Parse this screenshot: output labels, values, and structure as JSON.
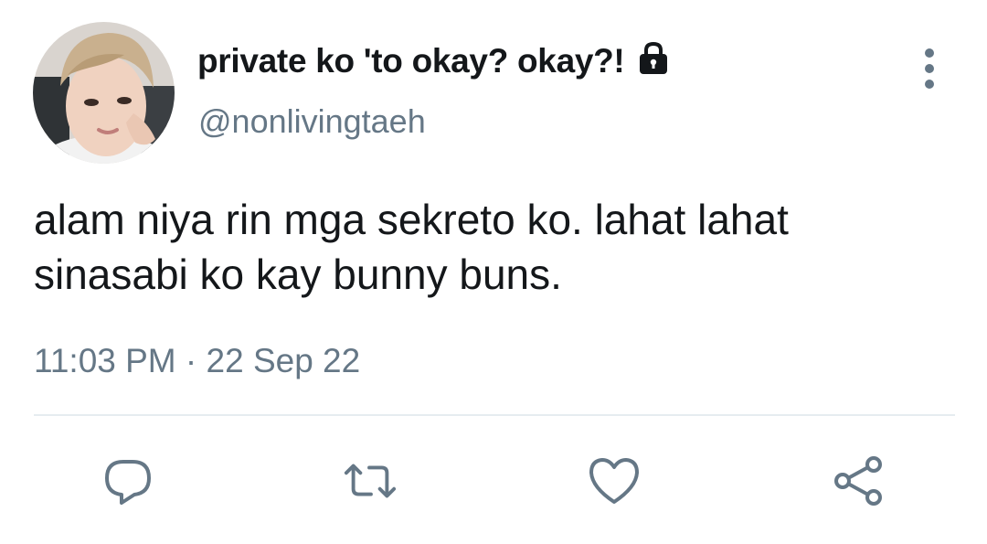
{
  "tweet": {
    "display_name": "private ko 'to okay? okay?!",
    "handle": "@nonlivingtaeh",
    "text": "alam niya rin mga sekreto ko. lahat lahat\nsinasabi ko kay bunny buns.",
    "timestamp": "11:03 PM · 22 Sep 22",
    "protected": true
  },
  "icons": {
    "lock": "lock-icon",
    "more": "vertical-ellipsis-icon",
    "reply": "reply-icon",
    "retweet": "retweet-icon",
    "like": "heart-icon",
    "share": "share-icon"
  },
  "colors": {
    "text_primary": "#14171a",
    "text_secondary": "#657786",
    "divider": "#e6ecf0"
  }
}
